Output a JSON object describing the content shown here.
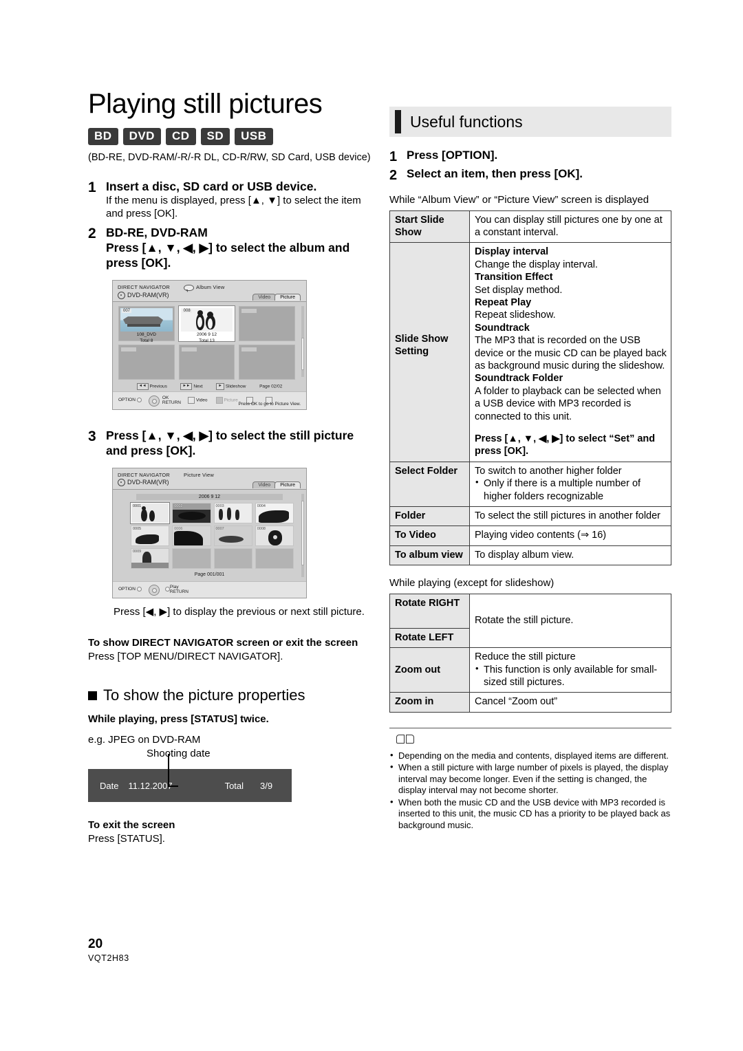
{
  "document": {
    "page_number": "20",
    "doc_code": "VQT2H83"
  },
  "left": {
    "title": "Playing still pictures",
    "media_badges": [
      "BD",
      "DVD",
      "CD",
      "SD",
      "USB"
    ],
    "media_note": "(BD-RE, DVD-RAM/-R/-R DL, CD-R/RW, SD Card, USB device)",
    "steps": [
      {
        "num": "1",
        "head": "Insert a disc, SD card or USB device.",
        "sub": "If the menu is displayed, press [▲, ▼] to select the item and press [OK]."
      },
      {
        "num": "2",
        "head_line1": "BD-RE, DVD-RAM",
        "head_line2": "Press [▲, ▼, ◀, ▶] to select the album and press [OK]."
      },
      {
        "num": "3",
        "head": "Press [▲, ▼, ◀, ▶] to select the still picture and press [OK]."
      }
    ],
    "album_screen": {
      "header_title": "DIRECT NAVIGATOR",
      "view_label": "Album View",
      "disc_label": "DVD-RAM(VR)",
      "tabs": [
        "Video",
        "Picture"
      ],
      "active_tab": "Picture",
      "cells": [
        {
          "num": "007",
          "line1": "108_DVD",
          "line2": "Total 8",
          "kind": "ship"
        },
        {
          "num": "008",
          "line1": "2006 9 12",
          "line2": "Total 13",
          "kind": "penguin",
          "selected": true
        },
        {
          "num": "",
          "line1": "",
          "line2": "",
          "kind": "empty"
        },
        {
          "num": "",
          "line1": "",
          "line2": "",
          "kind": "empty"
        },
        {
          "num": "",
          "line1": "",
          "line2": "",
          "kind": "empty"
        },
        {
          "num": "",
          "line1": "",
          "line2": "",
          "kind": "empty"
        }
      ],
      "footer": {
        "previous": "Previous",
        "next": "Next",
        "slideshow": "Slideshow",
        "page": "Page 02/02"
      },
      "bottom": {
        "option": "OPTION",
        "ok": "OK",
        "return": "RETURN",
        "video": "Video",
        "picture": "Picture",
        "hint": "Press OK to go to Picture View."
      }
    },
    "picture_screen": {
      "header_title": "DIRECT NAVIGATOR",
      "view_label": "Picture View",
      "disc_label": "DVD-RAM(VR)",
      "tabs": [
        "Video",
        "Picture"
      ],
      "active_tab": "Picture",
      "date_bar": "2006 9 12",
      "cells": [
        "0001",
        "0002",
        "0003",
        "0004",
        "0005",
        "0006",
        "0007",
        "0008",
        "0009",
        "",
        "",
        ""
      ],
      "selected_index": 0,
      "page": "Page  001/001",
      "bottom": {
        "option": "OPTION",
        "play": "Play",
        "return": "RETURN"
      }
    },
    "below_picture_screen": "Press [◀, ▶] to display the previous or next still picture.",
    "direct_nav_head": "To show DIRECT NAVIGATOR screen or exit the screen",
    "direct_nav_body": "Press [TOP MENU/DIRECT NAVIGATOR].",
    "properties_heading": "To show the picture properties",
    "properties_bold": "While playing, press [STATUS] twice.",
    "properties_eg": "e.g. JPEG on DVD-RAM",
    "shooting_date_label": "Shooting date",
    "status_bar": {
      "date_label": "Date",
      "date_value": "11.12.2007",
      "total_label": "Total",
      "total_value": "3/9"
    },
    "exit_head": "To exit the screen",
    "exit_body": "Press [STATUS]."
  },
  "right": {
    "section_title": "Useful functions",
    "steps": [
      {
        "num": "1",
        "text": "Press [OPTION]."
      },
      {
        "num": "2",
        "text": "Select an item, then press [OK]."
      }
    ],
    "table1_caption": "While “Album View” or “Picture View” screen is displayed",
    "table1": [
      {
        "key": "Start Slide Show",
        "value": "You can display still pictures one by one at a constant interval."
      },
      {
        "key": "Slide Show Setting",
        "blocks": [
          {
            "b": "Display interval",
            "t": "Change the display interval."
          },
          {
            "b": "Transition Effect",
            "t": "Set display method."
          },
          {
            "b": "Repeat Play",
            "t": "Repeat slideshow."
          },
          {
            "b": "Soundtrack",
            "t": "The MP3 that is recorded on the USB device or the music CD can be played back as background music during the slideshow."
          },
          {
            "b": "Soundtrack Folder",
            "t": "A folder to playback can be selected when a USB device with MP3 recorded is connected to this unit."
          }
        ],
        "footer_bold": "Press [▲, ▼, ◀, ▶] to select “Set” and press [OK]."
      },
      {
        "key": "Select Folder",
        "value": "To switch to another higher folder",
        "bullets": [
          "Only if there is a multiple number of higher folders recognizable"
        ]
      },
      {
        "key": "Folder",
        "value": "To select the still pictures in another folder"
      },
      {
        "key": "To Video",
        "value": "Playing video contents (⇒ 16)"
      },
      {
        "key": "To album view",
        "value": "To display album view."
      }
    ],
    "table2_caption": "While playing (except for slideshow)",
    "table2": [
      {
        "key": "Rotate RIGHT",
        "key2": "Rotate LEFT",
        "value": "Rotate the still picture."
      },
      {
        "key": "Zoom out",
        "value": "Reduce the still picture",
        "bullets": [
          "This function is only available for small-sized still pictures."
        ]
      },
      {
        "key": "Zoom in",
        "value": "Cancel “Zoom out”"
      }
    ],
    "notes": [
      "Depending on the media and contents, displayed items are different.",
      "When a still picture with large number of pixels is played, the display interval may become longer. Even if the setting is changed, the display interval may not become shorter.",
      "When both the music CD and the USB device with MP3 recorded is inserted to this unit, the music CD has a priority to be played back as background music."
    ]
  }
}
